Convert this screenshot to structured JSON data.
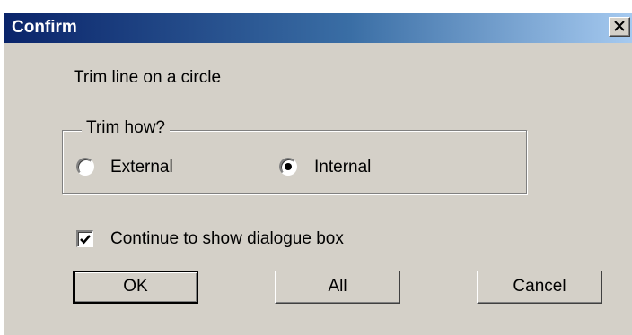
{
  "window": {
    "title": "Confirm",
    "close_glyph": "close-icon"
  },
  "prompt": "Trim line on a circle",
  "group": {
    "label": "Trim how?",
    "options": [
      {
        "label": "External",
        "selected": false
      },
      {
        "label": "Internal",
        "selected": true
      }
    ]
  },
  "checkbox": {
    "label": "Continue to show dialogue box",
    "checked": true
  },
  "buttons": {
    "ok": "OK",
    "all": "All",
    "cancel": "Cancel"
  }
}
